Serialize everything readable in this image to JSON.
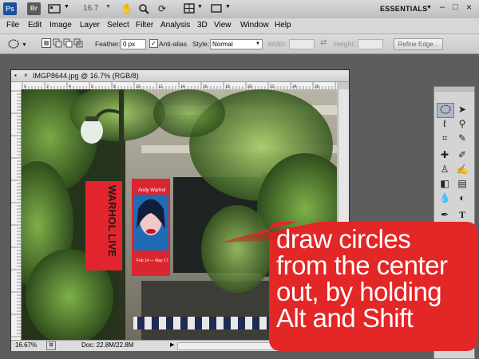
{
  "app": {
    "logo": "Ps",
    "bridge": "Br",
    "zoom_level": "16.7",
    "workspace": "ESSENTIALS",
    "workspace_arrow": "▼",
    "window_controls": [
      "–",
      "□",
      "×"
    ]
  },
  "menu": [
    "File",
    "Edit",
    "Image",
    "Layer",
    "Select",
    "Filter",
    "Analysis",
    "3D",
    "View",
    "Window",
    "Help"
  ],
  "options": {
    "feather_label": "Feather:",
    "feather_value": "0 px",
    "antialias_label": "Anti-alias",
    "style_label": "Style:",
    "style_value": "Normal",
    "width_label": "Width:",
    "height_label": "Height:",
    "refine_edge": "Refine Edge..."
  },
  "document": {
    "title": "IMGP8644.jpg @ 16.7% (RGB/8)",
    "zoom": "16.67%",
    "doc_size": "Doc: 22.8M/22.8M",
    "ruler_marks": [
      "0",
      "2",
      "4",
      "6",
      "8",
      "10",
      "12",
      "14",
      "16",
      "18",
      "20",
      "22",
      "24",
      "26",
      "28"
    ],
    "banner_left": "WARHOL LIVE",
    "banner_right_top": "Andy Warhol",
    "banner_right_bottom": "Feb 14 — May 17"
  },
  "callout": {
    "lines": [
      "draw circles",
      "from the center",
      "out, by holding",
      "Alt and Shift"
    ],
    "color": "#e32626"
  },
  "colors": {
    "ps_blue": "#1f4f9b",
    "chrome": "#d7d7d7",
    "callout_red": "#e32626"
  }
}
